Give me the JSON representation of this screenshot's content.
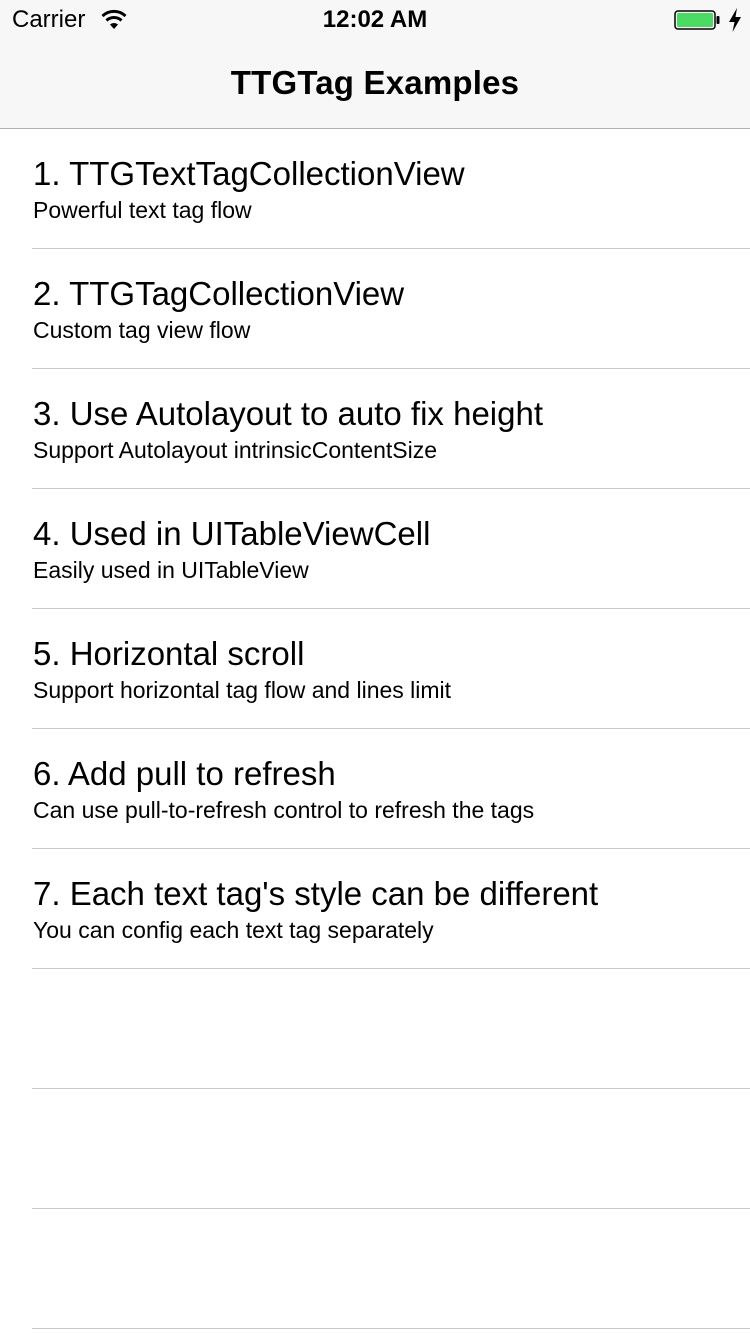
{
  "status_bar": {
    "carrier": "Carrier",
    "time": "12:02 AM",
    "wifi_icon": "wifi-icon",
    "battery_icon": "battery-icon",
    "charging_icon": "charging-bolt-icon",
    "battery_level": 1.0,
    "battery_color": "#4cd964"
  },
  "nav_bar": {
    "title": "TTGTag Examples"
  },
  "rows": [
    {
      "title": "1. TTGTextTagCollectionView",
      "subtitle": "Powerful text tag flow"
    },
    {
      "title": "2. TTGTagCollectionView",
      "subtitle": "Custom tag view flow"
    },
    {
      "title": "3. Use Autolayout to auto fix height",
      "subtitle": "Support Autolayout intrinsicContentSize"
    },
    {
      "title": "4. Used in UITableViewCell",
      "subtitle": "Easily used in UITableView"
    },
    {
      "title": "5. Horizontal scroll",
      "subtitle": "Support horizontal tag flow and lines limit"
    },
    {
      "title": "6. Add pull to refresh",
      "subtitle": "Can use pull-to-refresh control to refresh the tags"
    },
    {
      "title": "7. Each text tag's style can be different",
      "subtitle": "You can config each text tag separately"
    }
  ]
}
